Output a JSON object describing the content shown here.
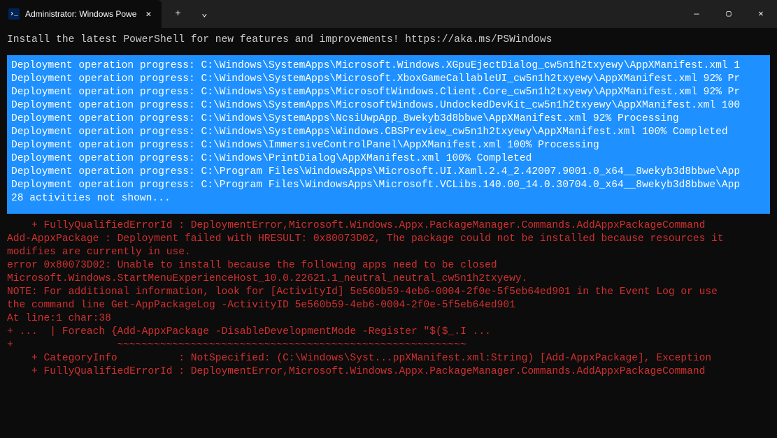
{
  "titlebar": {
    "tab_title": "Administrator: Windows Powe",
    "tab_icon_glyph": "›_",
    "close_glyph": "✕",
    "new_tab_glyph": "+",
    "dropdown_glyph": "⌄"
  },
  "window_controls": {
    "minimize": "—",
    "maximize": "▢",
    "close": "✕"
  },
  "banner": "Install the latest PowerShell for new features and improvements! https://aka.ms/PSWindows",
  "progress_lines": [
    "Deployment operation progress: C:\\Windows\\SystemApps\\Microsoft.Windows.XGpuEjectDialog_cw5n1h2txyewy\\AppXManifest.xml 1",
    "Deployment operation progress: C:\\Windows\\SystemApps\\Microsoft.XboxGameCallableUI_cw5n1h2txyewy\\AppXManifest.xml 92% Pr",
    "Deployment operation progress: C:\\Windows\\SystemApps\\MicrosoftWindows.Client.Core_cw5n1h2txyewy\\AppXManifest.xml 92% Pr",
    "Deployment operation progress: C:\\Windows\\SystemApps\\MicrosoftWindows.UndockedDevKit_cw5n1h2txyewy\\AppXManifest.xml 100",
    "Deployment operation progress: C:\\Windows\\SystemApps\\NcsiUwpApp_8wekyb3d8bbwe\\AppXManifest.xml 92% Processing",
    "Deployment operation progress: C:\\Windows\\SystemApps\\Windows.CBSPreview_cw5n1h2txyewy\\AppXManifest.xml 100% Completed",
    "Deployment operation progress: C:\\Windows\\ImmersiveControlPanel\\AppXManifest.xml 100% Processing",
    "Deployment operation progress: C:\\Windows\\PrintDialog\\AppXManifest.xml 100% Completed",
    "Deployment operation progress: C:\\Program Files\\WindowsApps\\Microsoft.UI.Xaml.2.4_2.42007.9001.0_x64__8wekyb3d8bbwe\\App",
    "Deployment operation progress: C:\\Program Files\\WindowsApps\\Microsoft.VCLibs.140.00_14.0.30704.0_x64__8wekyb3d8bbwe\\App",
    "28 activities not shown..."
  ],
  "error_lines": [
    "    + FullyQualifiedErrorId : DeploymentError,Microsoft.Windows.Appx.PackageManager.Commands.AddAppxPackageCommand",
    "",
    "Add-AppxPackage : Deployment failed with HRESULT: 0x80073D02, The package could not be installed because resources it",
    "modifies are currently in use.",
    "error 0x80073D02: Unable to install because the following apps need to be closed",
    "Microsoft.Windows.StartMenuExperienceHost_10.0.22621.1_neutral_neutral_cw5n1h2txyewy.",
    "NOTE: For additional information, look for [ActivityId] 5e560b59-4eb6-0004-2f0e-5f5eb64ed901 in the Event Log or use",
    "the command line Get-AppPackageLog -ActivityID 5e560b59-4eb6-0004-2f0e-5f5eb64ed901",
    "At line:1 char:38",
    "+ ...  | Foreach {Add-AppxPackage -DisableDevelopmentMode -Register \"$($_.I ...",
    "+                 ~~~~~~~~~~~~~~~~~~~~~~~~~~~~~~~~~~~~~~~~~~~~~~~~~~~~~~~~~",
    "    + CategoryInfo          : NotSpecified: (C:\\Windows\\Syst...ppXManifest.xml:String) [Add-AppxPackage], Exception",
    "    + FullyQualifiedErrorId : DeploymentError,Microsoft.Windows.Appx.PackageManager.Commands.AddAppxPackageCommand"
  ]
}
